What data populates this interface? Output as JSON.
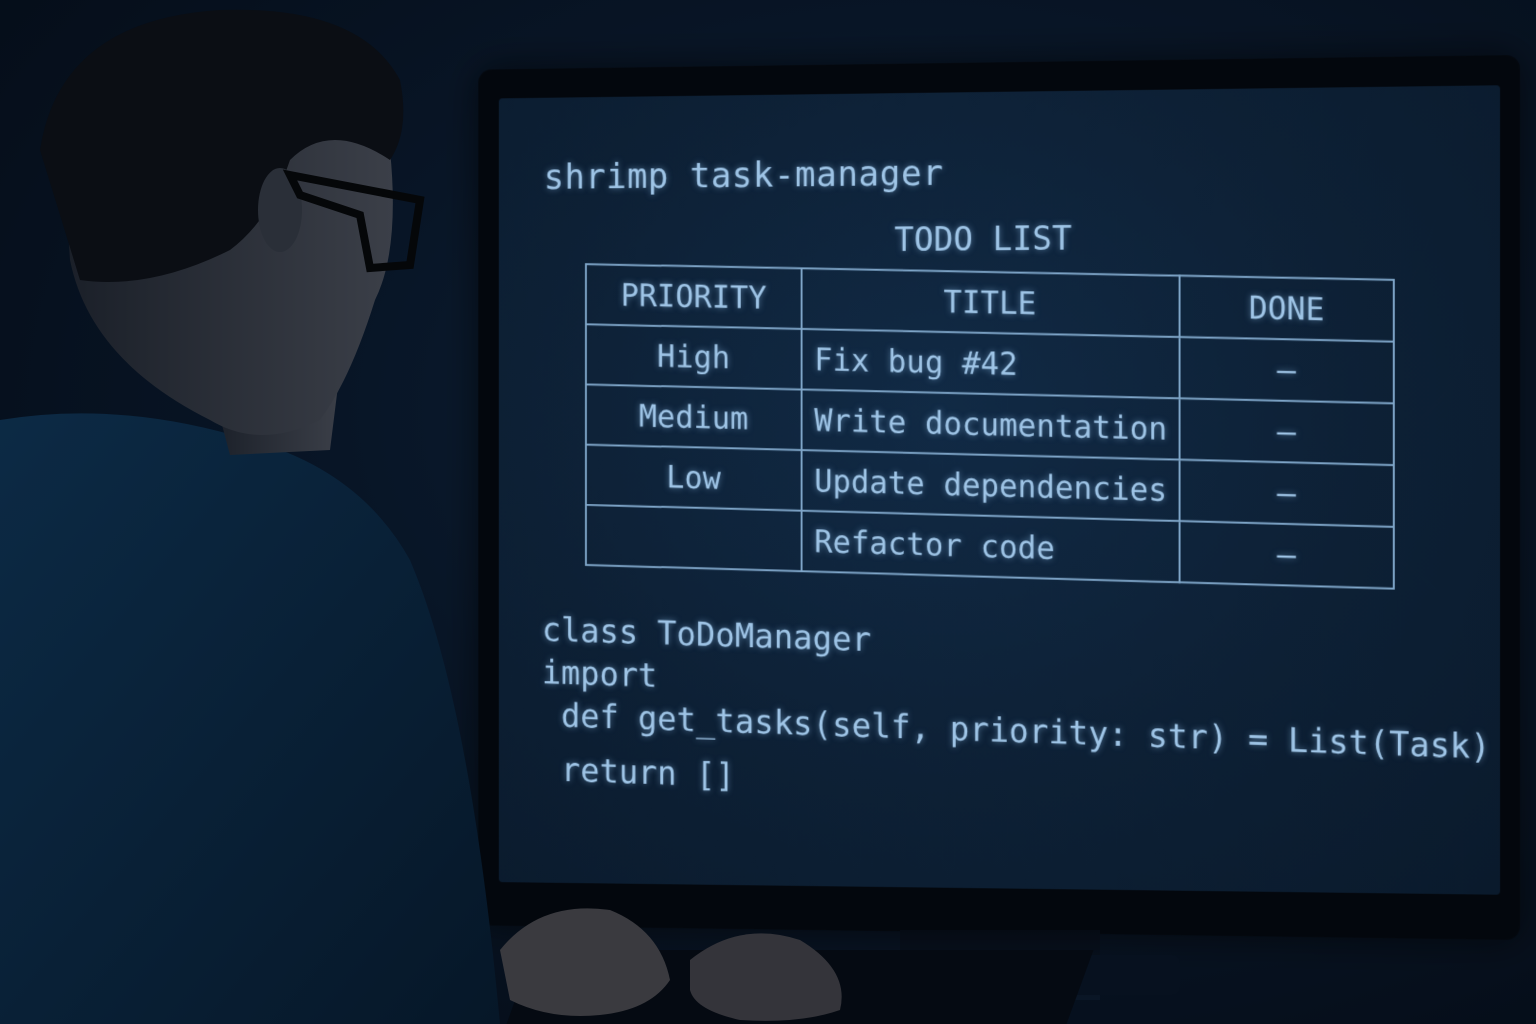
{
  "screen": {
    "app_title": "shrimp task-manager",
    "table_title": "TODO LIST",
    "table": {
      "headers": {
        "priority": "PRIORITY",
        "title": "TITLE",
        "done": "DONE"
      },
      "rows": [
        {
          "priority": "High",
          "title": "Fix bug #42",
          "done": "–"
        },
        {
          "priority": "Medium",
          "title": "Write documentation",
          "done": "–"
        },
        {
          "priority": "Low",
          "title": "Update dependencies",
          "done": "–"
        },
        {
          "priority": "",
          "title": "Refactor code",
          "done": "–"
        }
      ]
    },
    "code": {
      "line1": "class ToDoManager",
      "line2": "import",
      "line3": " def get_tasks(self, priority: str) = List(Task)",
      "line4": " return []"
    }
  },
  "colors": {
    "screen_text": "#9ec4e6",
    "screen_background": "#0d2035",
    "room_background": "#06101d"
  }
}
